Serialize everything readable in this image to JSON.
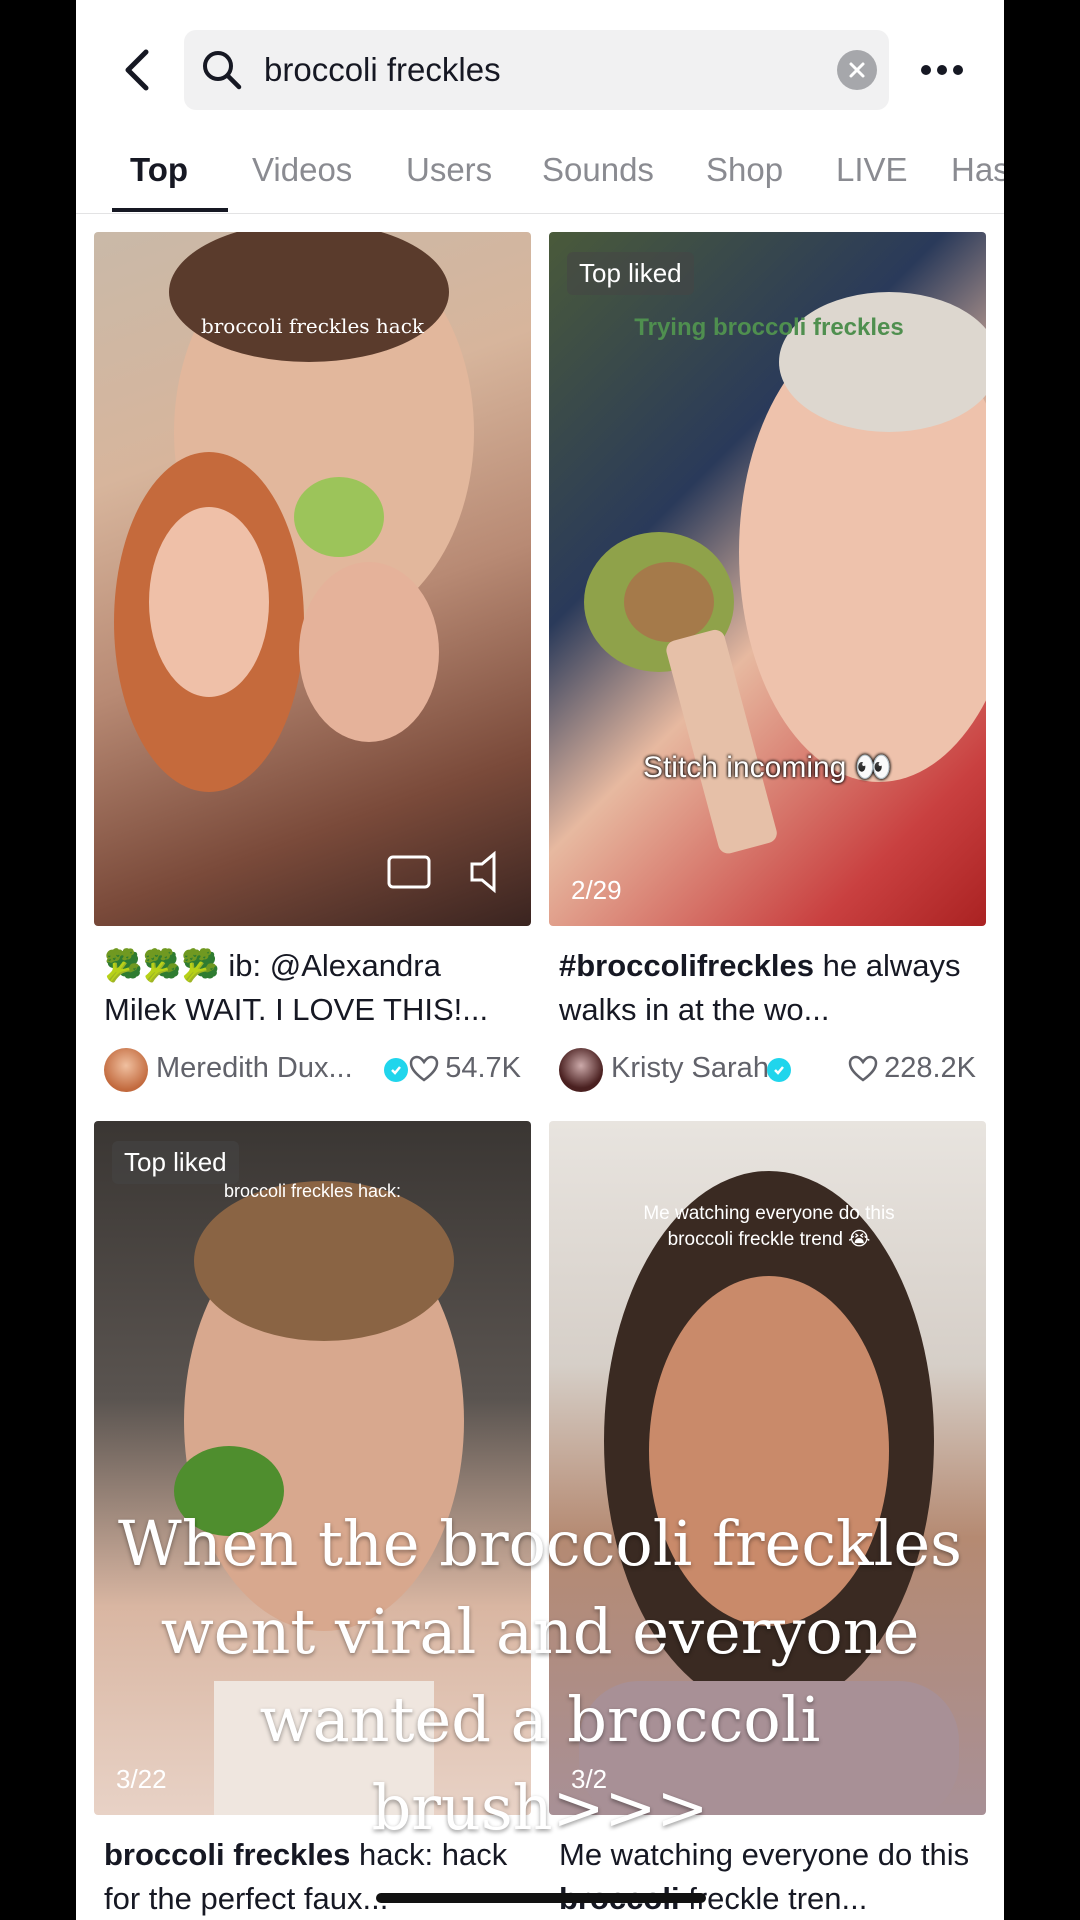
{
  "search": {
    "query": "broccoli freckles"
  },
  "tabs": [
    "Top",
    "Videos",
    "Users",
    "Sounds",
    "Shop",
    "LIVE",
    "Has"
  ],
  "results": [
    {
      "overlay_top": "broccoli freckles hack",
      "caption_bold": "",
      "caption_rest": "ib: @Alexandra Milek WAIT.  I LOVE THIS!...",
      "author": "Meredith Dux...",
      "likes": "54.7K"
    },
    {
      "badge": "Top liked",
      "overlay_top": "Trying broccoli freckles",
      "overlay_mid": "Stitch incoming 👀",
      "counter": "2/29",
      "caption_bold": "#broccolifreckles",
      "caption_rest": " he always walks in at the wo...",
      "author": "Kristy Sarah",
      "likes": "228.2K"
    },
    {
      "badge": "Top liked",
      "overlay_top": "broccoli freckles hack:",
      "counter": "3/22",
      "caption_bold": "broccoli freckles",
      "caption_rest": " hack: hack for the perfect faux..."
    },
    {
      "overlay_top": "Me watching everyone do this broccoli freckle trend 😭",
      "counter": "3/2",
      "caption_pre": "Me watching everyone do this ",
      "caption_bold": "broccoli",
      "caption_rest": " freckle tren..."
    }
  ],
  "big_overlay": "When the broccoli freckles went viral and everyone wanted a broccoli brush>>>",
  "colors": {
    "text_primary": "#161823",
    "text_secondary": "#61626a",
    "verified": "#20d5ec"
  }
}
